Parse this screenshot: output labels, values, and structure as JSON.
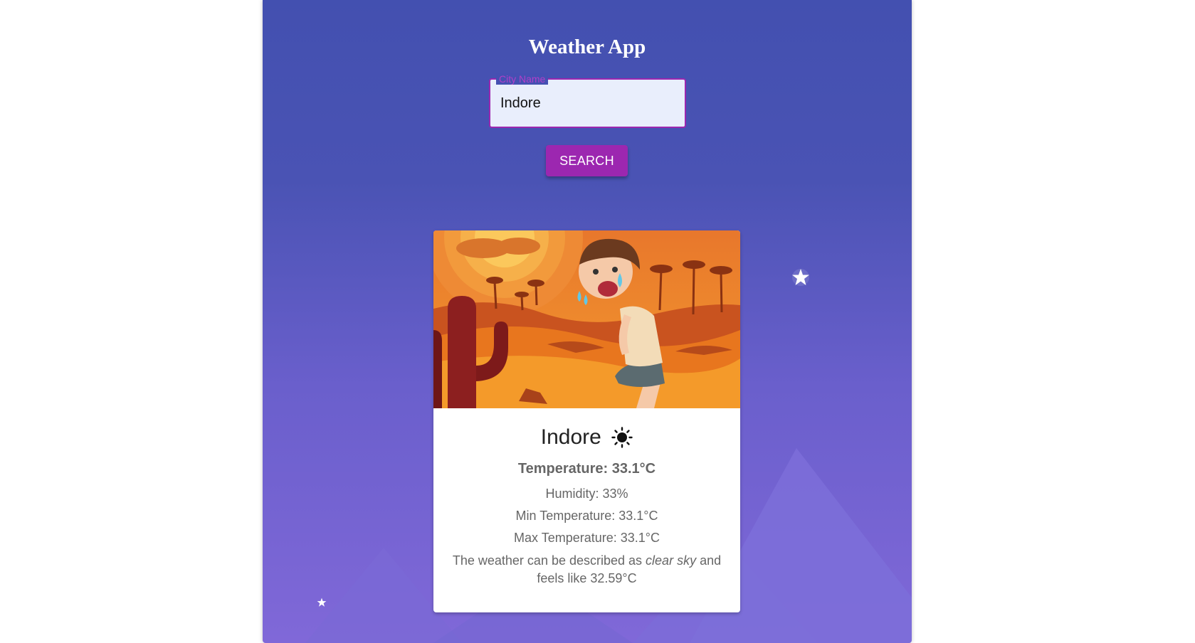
{
  "app": {
    "title": "Weather App"
  },
  "search": {
    "field_label": "City Name",
    "value": "Indore",
    "button_label": "SEARCH"
  },
  "weather": {
    "city": "Indore",
    "condition_icon": "sun-icon",
    "temperature": "Temperature: 33.1°C",
    "humidity": "Humidity: 33%",
    "min_temperature": "Min Temperature: 33.1°C",
    "max_temperature": "Max Temperature: 33.1°C",
    "description_prefix": "The weather can be described as ",
    "description_value": "clear sky",
    "description_suffix": " and feels like 32.59°C"
  },
  "colors": {
    "accent": "#9c27b0",
    "panel_top": "#4350b0",
    "panel_bottom": "#8068d8"
  }
}
